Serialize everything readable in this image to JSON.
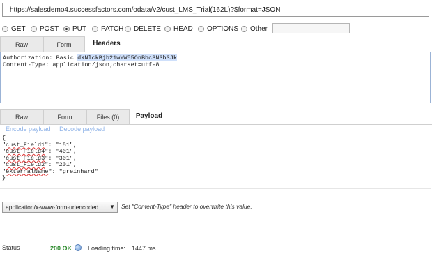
{
  "url": {
    "value": "https://salesdemo4.successfactors.com/odata/v2/cust_LMS_Trial(162L)?$format=JSON"
  },
  "methods": [
    {
      "label": "GET",
      "selected": false
    },
    {
      "label": "POST",
      "selected": false
    },
    {
      "label": "PUT",
      "selected": true
    },
    {
      "label": "PATCH",
      "selected": false
    },
    {
      "label": "DELETE",
      "selected": false
    },
    {
      "label": "HEAD",
      "selected": false
    },
    {
      "label": "OPTIONS",
      "selected": false
    },
    {
      "label": "Other",
      "selected": false
    }
  ],
  "header_tabs": {
    "raw": "Raw",
    "form": "Form",
    "headers": "Headers"
  },
  "headers_text": {
    "line1_key": "Authorization: Basic ",
    "line1_token": "dXNlckBjb21wYW55OnBhc3N3b3Jk",
    "line2": "Content-Type: application/json;charset=utf-8"
  },
  "payload_tabs": {
    "raw": "Raw",
    "form": "Form",
    "files": "Files (0)",
    "payload": "Payload"
  },
  "codec": {
    "encode": "Encode payload",
    "decode": "Decode payload"
  },
  "payload": {
    "open": "{",
    "lines": [
      {
        "key": "cust_Field1",
        "value": "\"151\","
      },
      {
        "key": "cust_Field4",
        "value": "\"401\","
      },
      {
        "key": "cust_Field3",
        "value": "\"301\","
      },
      {
        "key": "cust_Field2",
        "value": "\"201\","
      },
      {
        "key": "externalName",
        "value": "\"greinhard\""
      }
    ],
    "close": "}"
  },
  "content_type": {
    "selected": "application/x-www-form-urlencoded",
    "hint": "Set \"Content-Type\" header to overwrite this value."
  },
  "status": {
    "label": "Status",
    "code": "200 OK",
    "loading_label": "Loading time:",
    "loading_value": "1447 ms"
  },
  "colors": {
    "status_ok": "#2c8a2c",
    "codec_link": "#8fb3e8",
    "textarea_border": "#9bb3d6"
  }
}
